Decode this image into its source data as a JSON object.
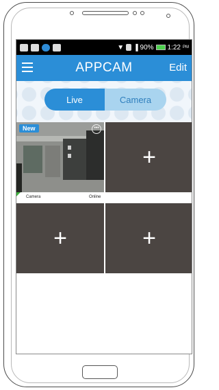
{
  "status_bar": {
    "battery": "90%",
    "time": "1:22",
    "ampm": "PM"
  },
  "app_bar": {
    "title": "APPCAM",
    "edit_label": "Edit"
  },
  "segment": {
    "live_label": "Live",
    "camera_label": "Camera"
  },
  "camera": {
    "name": "Camera",
    "status": "Online",
    "badge": "New"
  },
  "add_label": "+"
}
